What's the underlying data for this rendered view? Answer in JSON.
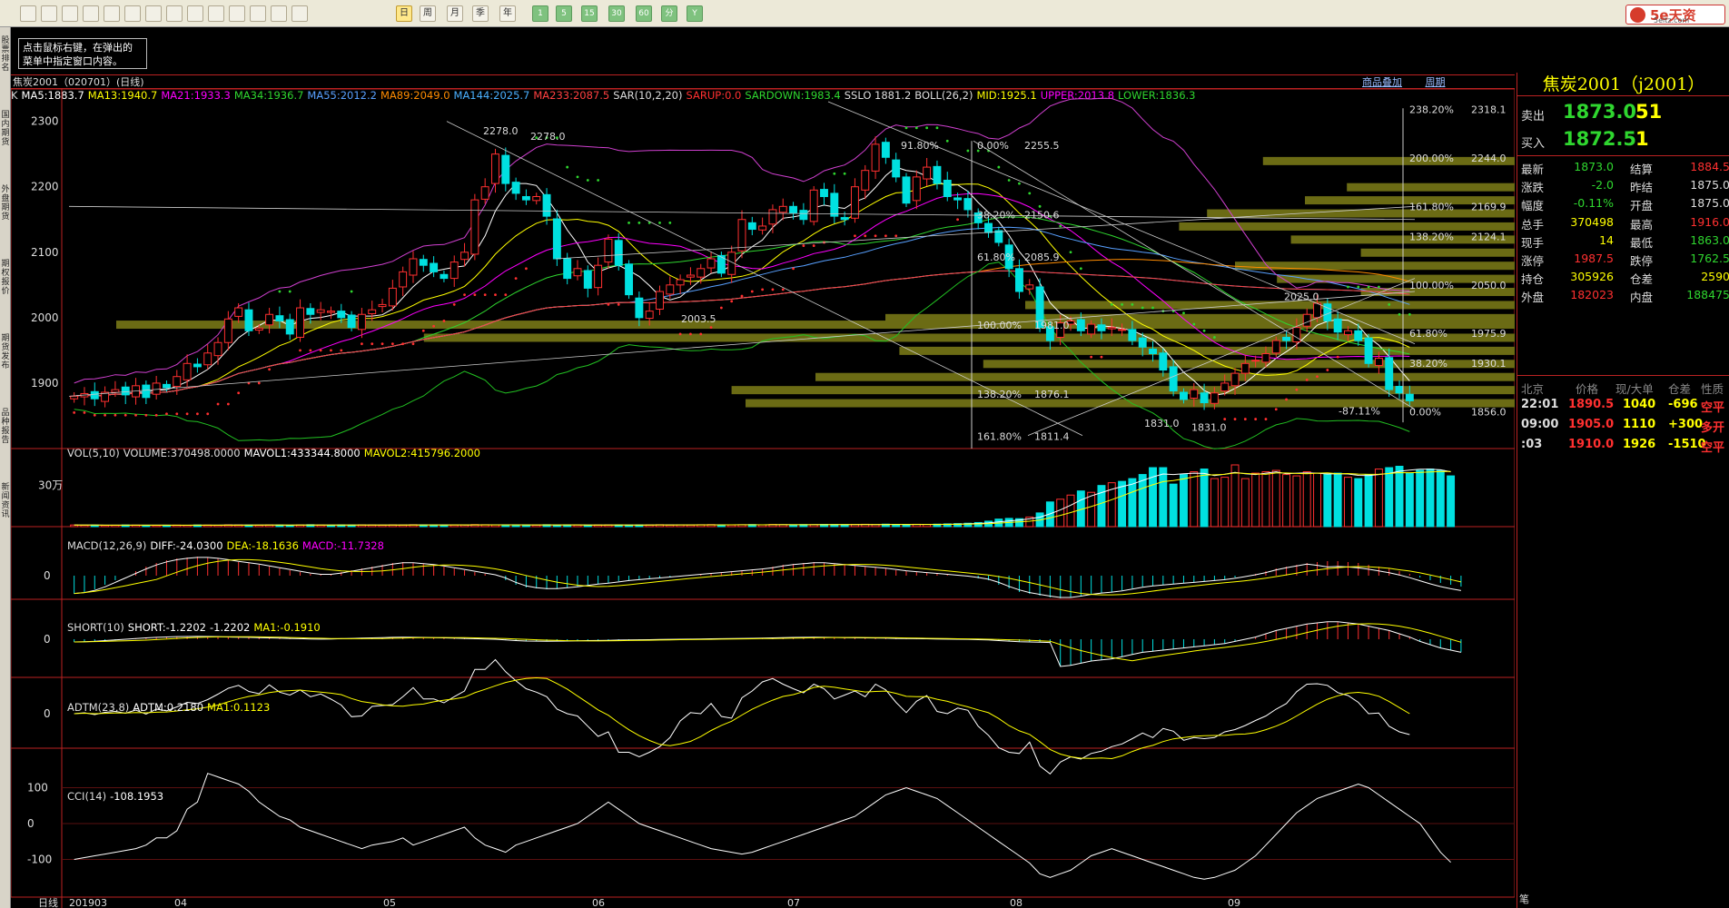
{
  "toolbar": {
    "icons": [
      "home-icon",
      "back-icon",
      "report-icon",
      "refresh-icon",
      "zoom-in-icon",
      "zoom-out-icon",
      "window-icon",
      "draw-icon",
      "color-icon",
      "filter-icon",
      "news-icon",
      "table-icon",
      "trend-icon",
      "kline-icon"
    ],
    "periods": [
      "日",
      "周",
      "月",
      "季",
      "年",
      "1",
      "5",
      "15",
      "30",
      "60",
      "分",
      "Y"
    ]
  },
  "logo": {
    "brand": "5e天资",
    "url": "5eitz.com"
  },
  "left_tabs": [
    "股票排名",
    "国内期货",
    "外盘期货",
    "期权报价",
    "期货发布",
    "品种报告",
    "新闻资讯"
  ],
  "tooltip": {
    "line1": "点击鼠标右键，在弹出的",
    "line2": "菜单中指定窗口内容。"
  },
  "tab": {
    "name": "焦炭2001（020701）(日线)",
    "right_links": [
      "商品叠加",
      "周期"
    ]
  },
  "header": [
    {
      "t": "K",
      "c": "#ddd"
    },
    {
      "t": "MA5:1883.7",
      "c": "#fff"
    },
    {
      "t": "MA13:1940.7",
      "c": "#ff0"
    },
    {
      "t": "MA21:1933.3",
      "c": "#f0f"
    },
    {
      "t": "MA34:1936.7",
      "c": "#2fd62f"
    },
    {
      "t": "MA55:2012.2",
      "c": "#58a0ff"
    },
    {
      "t": "MA89:2049.0",
      "c": "#ff8c00"
    },
    {
      "t": "MA144:2025.7",
      "c": "#4ab0ff"
    },
    {
      "t": "MA233:2087.5",
      "c": "#ff4040"
    },
    {
      "t": "SAR(10,2,20)",
      "c": "#ddd"
    },
    {
      "t": "SARUP:0.0",
      "c": "#ff3030"
    },
    {
      "t": "SARDOWN:1983.4",
      "c": "#2fd62f"
    },
    {
      "t": "SSLO 1881.2",
      "c": "#ddd"
    },
    {
      "t": "BOLL(26,2)",
      "c": "#ddd"
    },
    {
      "t": "MID:1925.1",
      "c": "#ff0"
    },
    {
      "t": "UPPER:2013.8",
      "c": "#f0f"
    },
    {
      "t": "LOWER:1836.3",
      "c": "#2fd62f"
    }
  ],
  "indicators": [
    {
      "key": "vol",
      "top": 492,
      "items": [
        {
          "t": "VOL(5,10)",
          "c": "#ddd"
        },
        {
          "t": "VOLUME:370498.0000",
          "c": "#ddd"
        },
        {
          "t": "MAVOL1:433344.8000",
          "c": "#fff"
        },
        {
          "t": "MAVOL2:415796.2000",
          "c": "#ff0"
        }
      ]
    },
    {
      "key": "macd",
      "top": 594,
      "items": [
        {
          "t": "MACD(12,26,9)",
          "c": "#ddd"
        },
        {
          "t": "DIFF:-24.0300",
          "c": "#fff"
        },
        {
          "t": "DEA:-18.1636",
          "c": "#ff0"
        },
        {
          "t": "MACD:-11.7328",
          "c": "#f0f"
        }
      ]
    },
    {
      "key": "short",
      "top": 684,
      "items": [
        {
          "t": "SHORT(10)",
          "c": "#ddd"
        },
        {
          "t": "SHORT:-1.2202",
          "c": "#fff"
        },
        {
          "t": "-1.2202",
          "c": "#fff"
        },
        {
          "t": "MA1:-0.1910",
          "c": "#ff0"
        }
      ]
    },
    {
      "key": "adtm",
      "top": 772,
      "items": [
        {
          "t": "ADTM(23,8)",
          "c": "#ddd"
        },
        {
          "t": "ADTM:0.2180",
          "c": "#fff"
        },
        {
          "t": "MA1:0.1123",
          "c": "#ff0"
        }
      ]
    },
    {
      "key": "cci",
      "top": 870,
      "items": [
        {
          "t": "CCI(14)",
          "c": "#ddd"
        },
        {
          "t": "-108.1953",
          "c": "#fff"
        }
      ]
    }
  ],
  "axis": {
    "price_ticks": [
      "2300",
      "2200",
      "2100",
      "2000",
      "1900"
    ],
    "vol_tick": "30万",
    "zero": "0",
    "cci_ticks": [
      "100",
      "0",
      "-100"
    ],
    "date_labels": [
      "201903",
      "04",
      "05",
      "06",
      "07",
      "08",
      "09"
    ],
    "period_label": "日线"
  },
  "annotations": {
    "high": "2278.0",
    "high2": "2278.0",
    "low_a": "2003.5",
    "fib_top": "91.80%",
    "fib_top2": "0.00%",
    "fib_top3": "2255.5",
    "fib_a": "38.20%",
    "fib_av": "2150.6",
    "fib_b": "61.80%",
    "fib_bv": "2085.9",
    "fib_c": "100.00%",
    "fib_cv": "1981.0",
    "fib_d": "138.20%",
    "fib_dv": "1876.1",
    "fib_e": "161.80%",
    "fib_ev": "1811.4",
    "low_b": "1831.0",
    "low_b2": "1831.0",
    "peak_c": "2025.0",
    "pct_neg": "-87.11%"
  },
  "fib_right": [
    {
      "pct": "238.20%",
      "val": "2318.1"
    },
    {
      "pct": "200.00%",
      "val": "2244.0"
    },
    {
      "pct": "161.80%",
      "val": "2169.9"
    },
    {
      "pct": "138.20%",
      "val": "2124.1"
    },
    {
      "pct": "100.00%",
      "val": "2050.0"
    },
    {
      "pct": "61.80%",
      "val": "1975.9"
    },
    {
      "pct": "38.20%",
      "val": "1930.1"
    },
    {
      "pct": "0.00%",
      "val": "1856.0"
    }
  ],
  "right_panel": {
    "title": "焦炭2001（j2001）",
    "sell": {
      "label": "卖出",
      "price": "1873.0",
      "qty": "51"
    },
    "buy": {
      "label": "买入",
      "price": "1872.5",
      "qty": "1"
    },
    "quotes": [
      {
        "l1": "最新",
        "v1": "1873.0",
        "c1": "#2fd62f",
        "l2": "结算",
        "v2": "1884.5",
        "c2": "#ff3030"
      },
      {
        "l1": "涨跌",
        "v1": "-2.0",
        "c1": "#2fd62f",
        "l2": "昨结",
        "v2": "1875.0",
        "c2": "#ddd"
      },
      {
        "l1": "幅度",
        "v1": "-0.11%",
        "c1": "#2fd62f",
        "l2": "开盘",
        "v2": "1875.0",
        "c2": "#ddd"
      },
      {
        "l1": "总手",
        "v1": "370498",
        "c1": "#ff0",
        "l2": "最高",
        "v2": "1916.0",
        "c2": "#ff3030"
      },
      {
        "l1": "现手",
        "v1": "14",
        "c1": "#ff0",
        "l2": "最低",
        "v2": "1863.0",
        "c2": "#2fd62f"
      },
      {
        "l1": "涨停",
        "v1": "1987.5",
        "c1": "#ff3030",
        "l2": "跌停",
        "v2": "1762.5",
        "c2": "#2fd62f"
      },
      {
        "l1": "持仓",
        "v1": "305926",
        "c1": "#ff0",
        "l2": "仓差",
        "v2": "2590",
        "c2": "#ff0"
      },
      {
        "l1": "外盘",
        "v1": "182023",
        "c1": "#ff3030",
        "l2": "内盘",
        "v2": "188475",
        "c2": "#2fd62f"
      }
    ],
    "tick_head": [
      "北京",
      "价格",
      "现/大单",
      "仓差",
      "性质"
    ],
    "ticks": [
      {
        "time": "22:01",
        "price": "1890.5",
        "vol": "1040",
        "diff": "-696",
        "nature": "空平",
        "pc": "#ff3030",
        "vc": "#ff0",
        "dc": "#ff0",
        "nc": "#ff3030"
      },
      {
        "time": "09:00",
        "price": "1905.0",
        "vol": "1110",
        "diff": "+300",
        "nature": "多开",
        "pc": "#ff3030",
        "vc": "#ff0",
        "dc": "#ff0",
        "nc": "#ff3030"
      },
      {
        "time": ":03",
        "price": "1910.0",
        "vol": "1926",
        "diff": "-1510",
        "nature": "空平",
        "pc": "#ff3030",
        "vc": "#ff0",
        "dc": "#ff0",
        "nc": "#ff3030"
      }
    ],
    "footer": "笔"
  },
  "chart_data": {
    "type": "candlestick",
    "title": "焦炭2001",
    "y_range": [
      1800,
      2330
    ],
    "closes": [
      1880,
      1884,
      1876,
      1886,
      1890,
      1882,
      1896,
      1878,
      1900,
      1893,
      1910,
      1930,
      1925,
      1946,
      1962,
      1998,
      2015,
      1980,
      1984,
      2005,
      1995,
      1975,
      2015,
      2005,
      2012,
      2010,
      2000,
      1985,
      2005,
      2012,
      2020,
      2045,
      2070,
      2090,
      2080,
      2070,
      2060,
      2085,
      2100,
      2180,
      2200,
      2250,
      2205,
      2190,
      2180,
      2185,
      2155,
      2090,
      2060,
      2075,
      2045,
      2080,
      2120,
      2080,
      2035,
      2000,
      2010,
      2040,
      2050,
      2058,
      2065,
      2075,
      2090,
      2068,
      2100,
      2150,
      2135,
      2140,
      2165,
      2170,
      2160,
      2150,
      2195,
      2185,
      2155,
      2150,
      2200,
      2225,
      2265,
      2245,
      2215,
      2175,
      2215,
      2230,
      2205,
      2185,
      2180,
      2165,
      2145,
      2130,
      2115,
      2075,
      2040,
      2050,
      1985,
      1965,
      1992,
      1995,
      1980,
      1990,
      1980,
      1985,
      1982,
      1965,
      1955,
      1945,
      1920,
      1888,
      1875,
      1890,
      1870,
      1885,
      1900,
      1915,
      1930,
      1935,
      1945,
      1965,
      1965,
      1985,
      2005,
      2022,
      1995,
      1978,
      1980,
      1965,
      1930,
      1938,
      1890,
      1885,
      1873
    ],
    "volume": [
      12,
      10,
      11,
      9,
      10,
      12,
      11,
      10,
      9,
      10,
      11,
      10,
      12,
      11,
      10,
      13,
      12,
      11,
      10,
      12,
      11,
      10,
      12,
      14,
      11,
      10,
      12,
      11,
      13,
      12,
      11,
      13,
      12,
      14,
      13,
      12,
      11,
      12,
      13,
      15,
      14,
      13,
      12,
      11,
      13,
      12,
      14,
      11,
      13,
      12,
      11,
      12,
      13,
      12,
      11,
      12,
      13,
      14,
      12,
      13,
      12,
      14,
      15,
      13,
      12,
      14,
      15,
      13,
      16,
      14,
      13,
      15,
      14,
      16,
      15,
      14,
      16,
      17,
      15,
      18,
      16,
      15,
      17,
      16,
      18,
      20,
      22,
      25,
      30,
      40,
      55,
      60,
      58,
      70,
      100,
      180,
      200,
      230,
      260,
      250,
      300,
      320,
      330,
      350,
      380,
      430,
      430,
      310,
      380,
      400,
      420,
      350,
      360,
      450,
      350,
      390,
      400,
      410,
      380,
      370,
      400,
      390,
      380,
      390,
      360,
      350,
      380,
      420,
      430,
      440,
      390,
      410,
      420,
      410,
      370
    ],
    "macd": [
      -20,
      -18,
      -15,
      -10,
      -5,
      0,
      5,
      10,
      14,
      17,
      19,
      20,
      21,
      20,
      19,
      17,
      15,
      14,
      12,
      10,
      8,
      6,
      4,
      2,
      1,
      2,
      4,
      6,
      8,
      10,
      12,
      14,
      15,
      14,
      13,
      12,
      10,
      8,
      6,
      4,
      2,
      0,
      -5,
      -10,
      -13,
      -14,
      -15,
      -14,
      -13,
      -12,
      -10,
      -9,
      -8,
      -6,
      -5,
      -4,
      -3,
      -2,
      -1,
      0,
      1,
      2,
      3,
      4,
      5,
      6,
      7,
      8,
      10,
      12,
      13,
      14,
      15,
      14,
      13,
      12,
      11,
      10,
      9,
      8,
      6,
      5,
      4,
      3,
      2,
      1,
      0,
      -1,
      -3,
      -5,
      -10,
      -14,
      -18,
      -20,
      -22,
      -24,
      -25,
      -24,
      -22,
      -20,
      -19,
      -18,
      -16,
      -14,
      -12,
      -11,
      -10,
      -9,
      -8,
      -7,
      -6,
      -5,
      -4,
      -2,
      0,
      2,
      5,
      8,
      10,
      12,
      14,
      15,
      16,
      16,
      15,
      14,
      12,
      10,
      8,
      5,
      2,
      -2,
      -5,
      -8,
      -10,
      -12
    ],
    "cci": [
      -100,
      -95,
      -90,
      -85,
      -80,
      -75,
      -70,
      -60,
      -40,
      -40,
      -20,
      40,
      60,
      140,
      130,
      120,
      110,
      90,
      60,
      40,
      20,
      10,
      -10,
      -20,
      -30,
      -40,
      -50,
      -60,
      -70,
      -60,
      -55,
      -50,
      -40,
      -60,
      -50,
      -40,
      -30,
      -20,
      -10,
      -40,
      -60,
      -70,
      -80,
      -60,
      -50,
      -40,
      -30,
      -20,
      -10,
      0,
      20,
      40,
      60,
      40,
      20,
      0,
      -10,
      -20,
      -30,
      -40,
      -50,
      -60,
      -70,
      -75,
      -80,
      -85,
      -80,
      -70,
      -60,
      -50,
      -40,
      -30,
      -20,
      -10,
      0,
      10,
      20,
      40,
      60,
      80,
      90,
      100,
      90,
      80,
      70,
      50,
      30,
      10,
      -10,
      -30,
      -50,
      -70,
      -90,
      -110,
      -140,
      -150,
      -140,
      -130,
      -110,
      -90,
      -80,
      -70,
      -80,
      -90,
      -100,
      -110,
      -120,
      -130,
      -140,
      -150,
      -155,
      -150,
      -140,
      -130,
      -110,
      -90,
      -60,
      -30,
      0,
      30,
      50,
      70,
      80,
      90,
      100,
      110,
      100,
      80,
      60,
      40,
      20,
      0,
      -40,
      -80,
      -108
    ],
    "cci_range": [
      -200,
      200
    ]
  }
}
